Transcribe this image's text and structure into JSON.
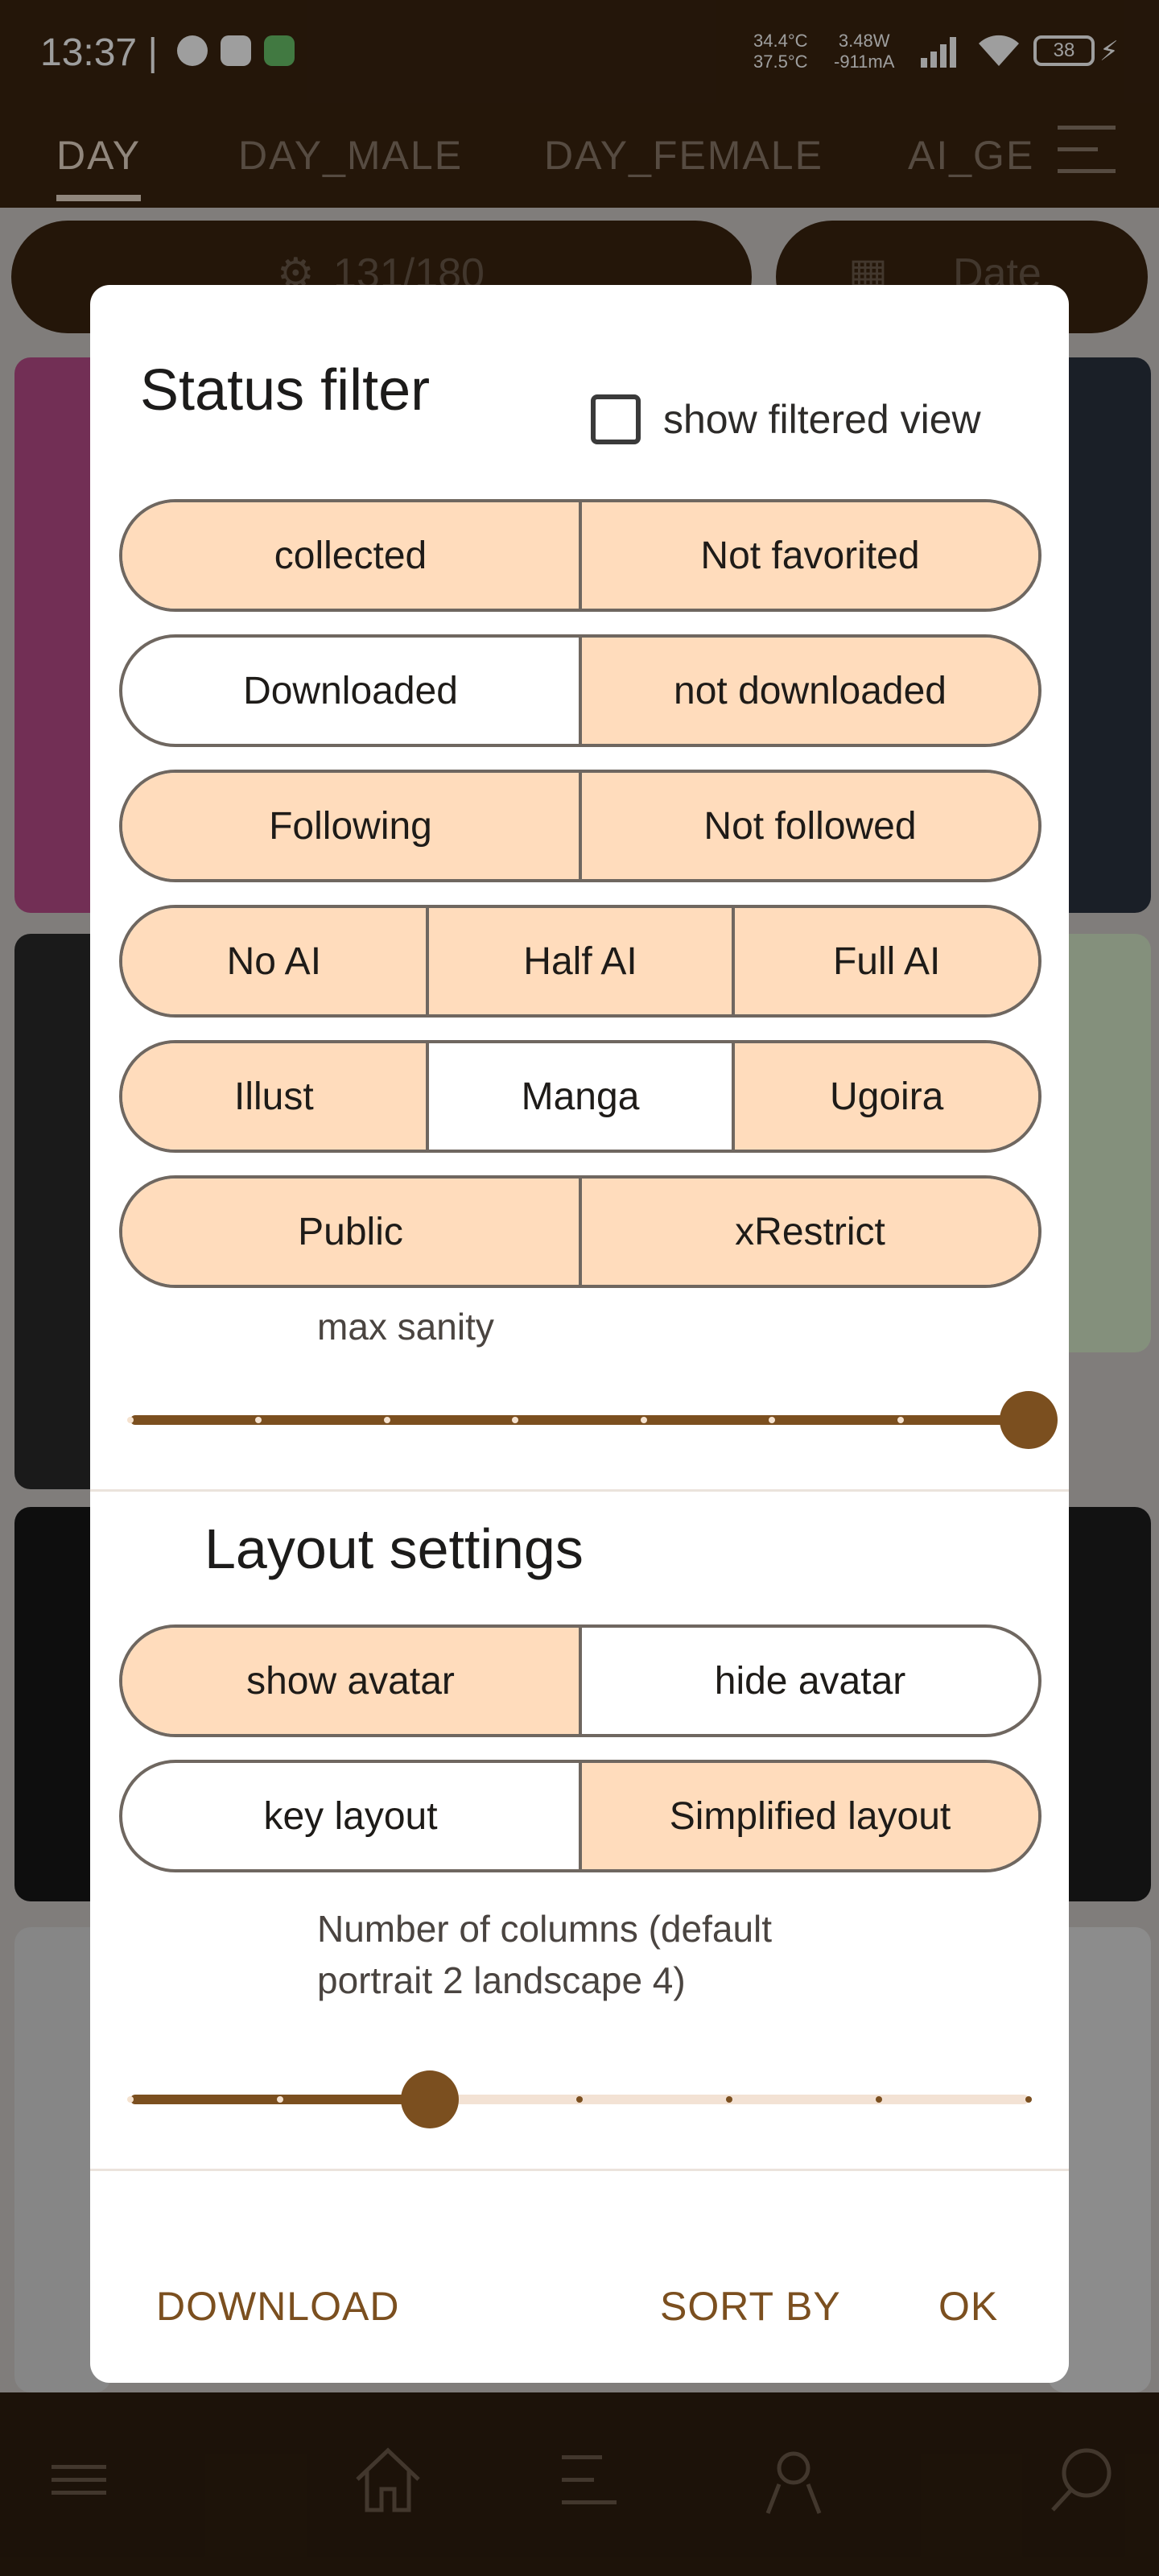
{
  "status_bar": {
    "time": "13:37 |",
    "temp_line1": "34.4°C",
    "temp_line2": "37.5°C",
    "power_line1": "3.48W",
    "power_line2": "-911mA",
    "battery": "38"
  },
  "tabs": [
    {
      "label": "DAY"
    },
    {
      "label": "DAY_MALE"
    },
    {
      "label": "DAY_FEMALE"
    },
    {
      "label": "AI_GE"
    }
  ],
  "toolbar": {
    "count": "131/180",
    "date": "Date"
  },
  "dialog": {
    "title": "Status filter",
    "show_filtered_label": "show filtered view",
    "show_filtered_checked": false,
    "filters": [
      {
        "options": [
          {
            "label": "collected",
            "selected": true
          },
          {
            "label": "Not favorited",
            "selected": true
          }
        ]
      },
      {
        "options": [
          {
            "label": "Downloaded",
            "selected": false
          },
          {
            "label": "not downloaded",
            "selected": true
          }
        ]
      },
      {
        "options": [
          {
            "label": "Following",
            "selected": true
          },
          {
            "label": "Not followed",
            "selected": true
          }
        ]
      },
      {
        "options": [
          {
            "label": "No AI",
            "selected": true
          },
          {
            "label": "Half AI",
            "selected": true
          },
          {
            "label": "Full AI",
            "selected": true
          }
        ]
      },
      {
        "options": [
          {
            "label": "Illust",
            "selected": true
          },
          {
            "label": "Manga",
            "selected": false
          },
          {
            "label": "Ugoira",
            "selected": true
          }
        ]
      },
      {
        "options": [
          {
            "label": "Public",
            "selected": true
          },
          {
            "label": "xRestrict",
            "selected": true
          }
        ]
      }
    ],
    "max_sanity": {
      "label": "max sanity",
      "steps": 8,
      "value_index": 7
    },
    "layout_title": "Layout settings",
    "layout": [
      {
        "options": [
          {
            "label": "show avatar",
            "selected": true
          },
          {
            "label": "hide avatar",
            "selected": false
          }
        ]
      },
      {
        "options": [
          {
            "label": "key layout",
            "selected": false
          },
          {
            "label": "Simplified layout",
            "selected": true
          }
        ]
      }
    ],
    "columns": {
      "label": "Number of columns (default portrait 2 landscape 4)",
      "steps": 7,
      "value_index": 2
    },
    "actions": {
      "download": "DOWNLOAD",
      "sort_by": "SORT BY",
      "ok": "OK"
    }
  },
  "colors": {
    "primary": "#7b4f1f",
    "selected_fill": "#ffdcbc",
    "app_bar": "#3a2410"
  },
  "bottom_nav": [
    "menu-icon",
    "home-icon",
    "list-icon",
    "person-icon",
    "search-icon"
  ]
}
